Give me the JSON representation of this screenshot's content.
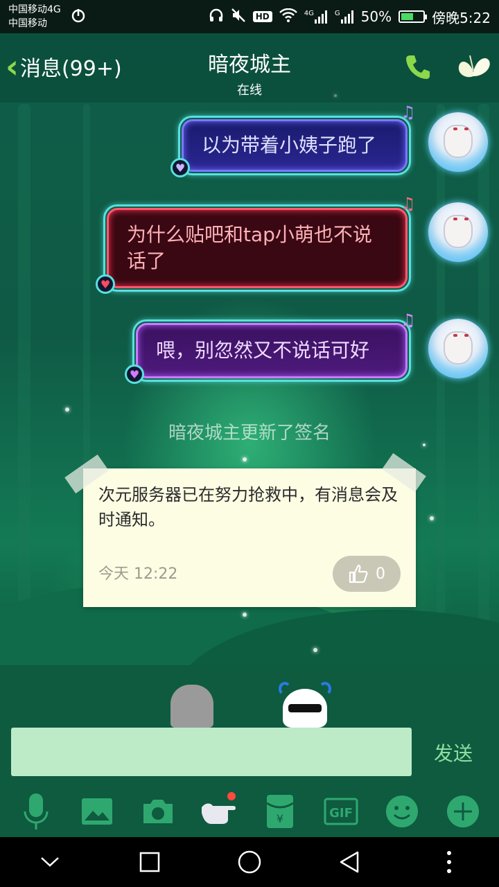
{
  "status_bar": {
    "carrier1": "中国移动4G",
    "carrier2": "中国移动",
    "network_label_1": "4G",
    "network_label_2": "G",
    "battery": "50%",
    "time": "傍晚5:22",
    "hd_label": "HD"
  },
  "header": {
    "back_label": "消息(99+)",
    "contact_name": "暗夜城主",
    "contact_status": "在线"
  },
  "messages": [
    {
      "text": "以为带着小姨子跑了",
      "color_theme": "#2a2690"
    },
    {
      "text": "为什么贴吧和tap小萌也不说话了",
      "color_theme": "#3a0812"
    },
    {
      "text": "喂，别忽然又不说话可好",
      "color_theme": "#4d1a7c"
    }
  ],
  "system_note": "暗夜城主更新了签名",
  "signature_card": {
    "text": "次元服务器已在努力抢救中，有消息会及时通知。",
    "time": "今天 12:22",
    "likes": "0"
  },
  "composer": {
    "input_value": "",
    "send_label": "发送"
  },
  "toolbar": {
    "items": [
      "mic-icon",
      "image-icon",
      "camera-icon",
      "poke-icon",
      "red-packet-icon",
      "gif-icon",
      "emoji-icon",
      "plus-icon"
    ],
    "gif_label": "GIF",
    "red_packet_symbol": "¥"
  },
  "colors": {
    "accent_green": "#8bd84b",
    "input_bg": "#bdebc8",
    "send_text": "#8be0a0"
  }
}
